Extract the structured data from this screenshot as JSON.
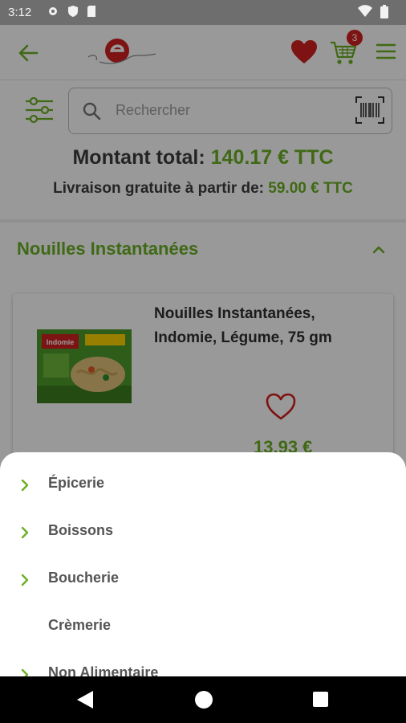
{
  "status_bar": {
    "time": "3:12"
  },
  "header": {
    "cart_count": "3",
    "brand_color": "#6ab023",
    "accent_color": "#d32020"
  },
  "search": {
    "placeholder": "Rechercher"
  },
  "totals": {
    "total_label": "Montant total:",
    "total_value": "140.17 € TTC",
    "shipping_label": "Livraison gratuite à partir de:",
    "shipping_value": "59.00 € TTC"
  },
  "category": {
    "title": "Nouilles Instantanées"
  },
  "product": {
    "name": "Nouilles Instantanées, Indomie, Légume, 75 gm",
    "price": "13.93 €",
    "package_label": "Indomie"
  },
  "sheet": {
    "items": [
      {
        "label": "Épicerie",
        "has_children": true
      },
      {
        "label": "Boissons",
        "has_children": true
      },
      {
        "label": "Boucherie",
        "has_children": true
      },
      {
        "label": "Crèmerie",
        "has_children": false
      },
      {
        "label": "Non Alimentaire",
        "has_children": true
      }
    ]
  }
}
